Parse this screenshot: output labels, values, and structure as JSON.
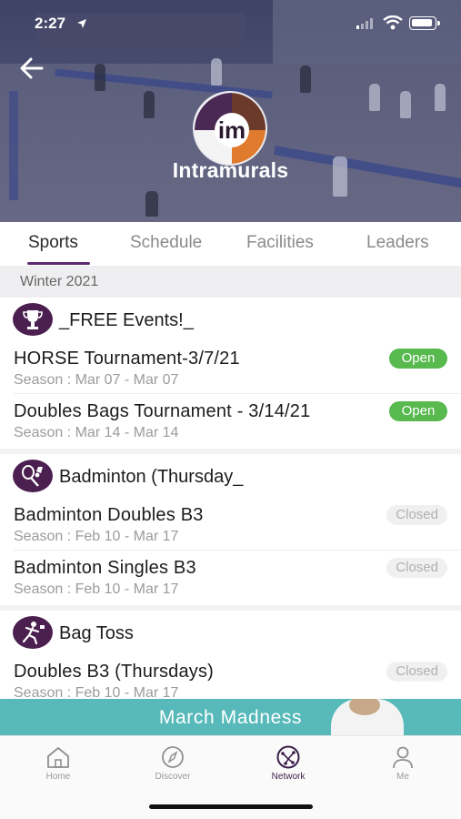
{
  "status_bar": {
    "time": "2:27"
  },
  "header": {
    "title": "Intramurals",
    "logo_text": "im"
  },
  "tabs": [
    {
      "label": "Sports",
      "active": true
    },
    {
      "label": "Schedule",
      "active": false
    },
    {
      "label": "Facilities",
      "active": false
    },
    {
      "label": "Leaders",
      "active": false
    }
  ],
  "season": {
    "label": "Winter 2021"
  },
  "groups": [
    {
      "name": "_FREE Events!_",
      "icon": "trophy-icon",
      "items": [
        {
          "title": "HORSE Tournament-3/7/21",
          "season": "Season : Mar 07 - Mar 07",
          "status": "Open"
        },
        {
          "title": "Doubles Bags Tournament - 3/14/21",
          "season": "Season : Mar 14 - Mar 14",
          "status": "Open"
        }
      ]
    },
    {
      "name": "Badminton (Thursday_",
      "icon": "badminton-icon",
      "items": [
        {
          "title": "Badminton Doubles B3",
          "season": "Season : Feb 10 - Mar 17",
          "status": "Closed"
        },
        {
          "title": "Badminton Singles B3",
          "season": "Season : Feb 10 - Mar 17",
          "status": "Closed"
        }
      ]
    },
    {
      "name": "Bag Toss",
      "icon": "bag-toss-icon",
      "items": [
        {
          "title": "Doubles B3 (Thursdays)",
          "season": "Season : Feb 10 - Mar 17",
          "status": "Closed"
        }
      ]
    }
  ],
  "promo": {
    "text": "March Madness"
  },
  "bottom_nav": [
    {
      "label": "Home",
      "icon": "home-icon",
      "active": false
    },
    {
      "label": "Discover",
      "icon": "compass-icon",
      "active": false
    },
    {
      "label": "Network",
      "icon": "network-icon",
      "active": true
    },
    {
      "label": "Me",
      "icon": "person-icon",
      "active": false
    }
  ],
  "colors": {
    "accent": "#5b2a6e",
    "open": "#58b94f",
    "closed_bg": "#f0f0f0",
    "promo": "#57b9b9",
    "group_icon_bg": "#4b1f4f"
  }
}
